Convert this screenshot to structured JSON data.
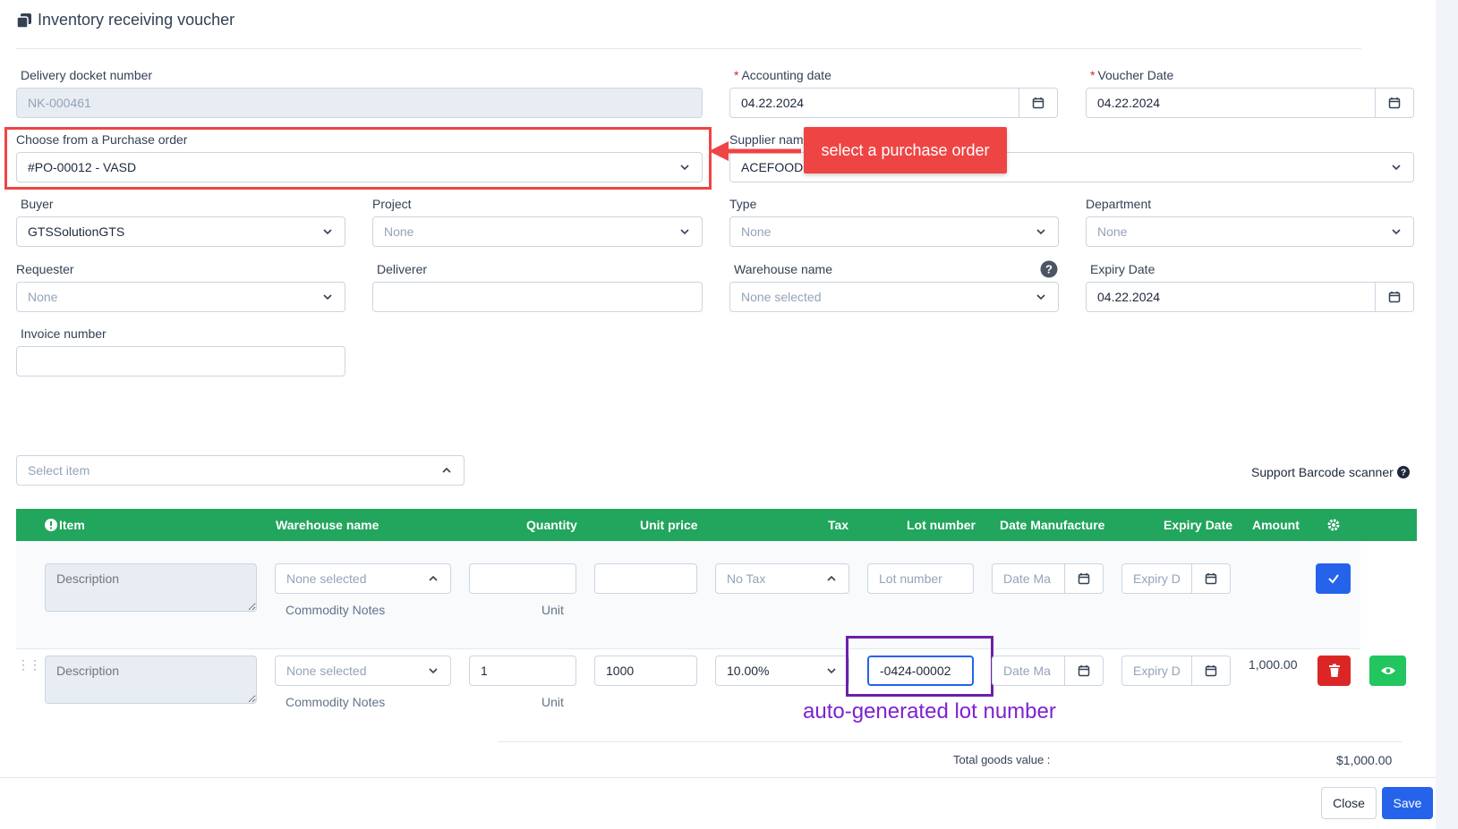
{
  "page": {
    "title": "Inventory receiving voucher"
  },
  "form": {
    "delivery_docket": {
      "label": "Delivery docket number",
      "value": "NK-000461"
    },
    "accounting_date": {
      "label": "Accounting date",
      "value": "04.22.2024"
    },
    "voucher_date": {
      "label": "Voucher Date",
      "value": "04.22.2024"
    },
    "purchase_order": {
      "label": "Choose from a Purchase order",
      "value": "#PO-00012 - VASD"
    },
    "supplier": {
      "label": "Supplier nam",
      "value": "ACEFOOD"
    },
    "buyer": {
      "label": "Buyer",
      "value": "GTSSolutionGTS"
    },
    "project": {
      "label": "Project",
      "value": "None"
    },
    "type": {
      "label": "Type",
      "value": "None"
    },
    "department": {
      "label": "Department",
      "value": "None"
    },
    "requester": {
      "label": "Requester",
      "value": "None"
    },
    "deliverer": {
      "label": "Deliverer",
      "value": ""
    },
    "warehouse": {
      "label": "Warehouse name",
      "value": "None selected"
    },
    "expiry_date": {
      "label": "Expiry Date",
      "value": "04.22.2024"
    },
    "invoice": {
      "label": "Invoice number",
      "value": ""
    }
  },
  "annotations": {
    "purchase_order_callout": "select a purchase order",
    "lot_callout": "auto-generated lot number"
  },
  "items": {
    "select_placeholder": "Select item",
    "barcode_label": "Support Barcode scanner",
    "columns": {
      "item": "Item",
      "warehouse": "Warehouse name",
      "quantity": "Quantity",
      "unit_price": "Unit price",
      "tax": "Tax",
      "lot": "Lot number",
      "date_manufacture": "Date Manufacture",
      "expiry": "Expiry Date",
      "amount": "Amount"
    },
    "new_row": {
      "description_placeholder": "Description",
      "warehouse": "None selected",
      "commodity_notes": "Commodity Notes",
      "unit": "Unit",
      "tax": "No Tax",
      "lot_placeholder": "Lot number",
      "date_manufacture_placeholder": "Date Ma",
      "expiry_placeholder": "Expiry D"
    },
    "row1": {
      "description_placeholder": "Description",
      "warehouse": "None selected",
      "commodity_notes": "Commodity Notes",
      "unit": "Unit",
      "quantity": "1",
      "unit_price": "1000",
      "tax": "10.00%",
      "lot": "-0424-00002",
      "date_manufacture_placeholder": "Date Ma",
      "expiry_placeholder": "Expiry D",
      "amount": "1,000.00"
    },
    "total_label": "Total goods value :",
    "total_value": "$1,000.00"
  },
  "footer": {
    "close": "Close",
    "save": "Save"
  },
  "colors": {
    "green": "#22a55c",
    "blue": "#2563eb",
    "red": "#dc2626",
    "annotation_red": "#ef4444",
    "annotation_purple": "#6b21a8"
  }
}
